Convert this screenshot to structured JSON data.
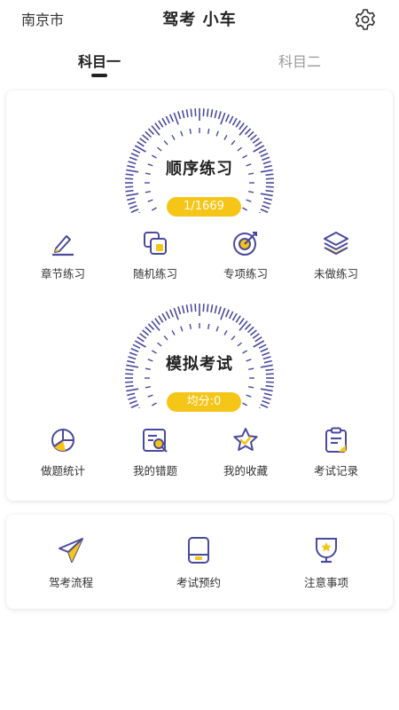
{
  "header": {
    "city": "南京市",
    "title": "驾考 小车",
    "settings_icon": "gear-icon"
  },
  "tabs": [
    {
      "label": "科目一",
      "active": true
    },
    {
      "label": "科目二",
      "active": false
    }
  ],
  "colors": {
    "accent_yellow": "#f5c518",
    "icon_purple": "#4a4a9c",
    "active_text": "#222222",
    "inactive_text": "#999999"
  },
  "practice": {
    "gauge_label": "顺序练习",
    "progress": "1/1669",
    "items": [
      {
        "label": "章节练习",
        "icon": "pencil-icon"
      },
      {
        "label": "随机练习",
        "icon": "shuffle-cards-icon"
      },
      {
        "label": "专项练习",
        "icon": "target-icon"
      },
      {
        "label": "未做练习",
        "icon": "layers-icon"
      }
    ]
  },
  "exam": {
    "gauge_label": "模拟考试",
    "score": "均分:0",
    "items": [
      {
        "label": "做题统计",
        "icon": "pie-chart-icon"
      },
      {
        "label": "我的错题",
        "icon": "error-search-icon"
      },
      {
        "label": "我的收藏",
        "icon": "star-icon"
      },
      {
        "label": "考试记录",
        "icon": "clipboard-icon"
      }
    ]
  },
  "tools": [
    {
      "label": "驾考流程",
      "icon": "paper-plane-icon"
    },
    {
      "label": "考试预约",
      "icon": "tablet-icon"
    },
    {
      "label": "注意事项",
      "icon": "trophy-icon"
    }
  ]
}
